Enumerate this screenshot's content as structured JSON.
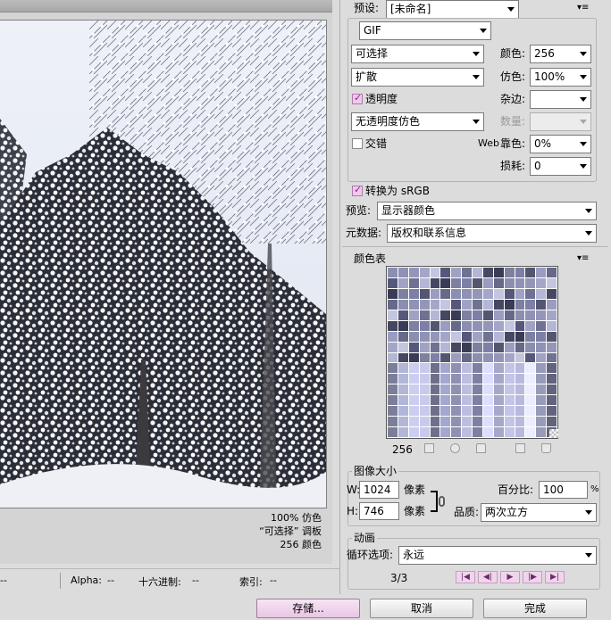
{
  "preview": {
    "dither_line": "100% 仿色",
    "palette_line": "“可选择” 调板",
    "colors_line": "256 颜色"
  },
  "status": {
    "left_value": "--",
    "alpha_label": "Alpha:",
    "alpha_value": "--",
    "hex_label": "十六进制:",
    "hex_value": "--",
    "index_label": "索引:",
    "index_value": "--"
  },
  "buttons": {
    "save": "存储...",
    "cancel": "取消",
    "done": "完成"
  },
  "settings": {
    "preset_label": "预设:",
    "preset_value": "[未命名]",
    "format": "GIF",
    "reduction": "可选择",
    "dither_algorithm": "扩散",
    "transparency_label": "透明度",
    "transparency_checked": true,
    "transparency_dither": "无透明度仿色",
    "interlaced_label": "交错",
    "interlaced_checked": false,
    "colors_label": "颜色:",
    "colors_value": "256",
    "dither_label": "仿色:",
    "dither_value": "100%",
    "matte_label": "杂边:",
    "matte_value": "",
    "amount_label": "数量:",
    "amount_value": "",
    "web_label": "Web",
    "web_snap_label": "靠色:",
    "web_snap_value": "0%",
    "lossy_label": "损耗:",
    "lossy_value": "0",
    "convert_srgb_label": "转换为 sRGB",
    "convert_srgb_checked": true,
    "preview_label": "预览:",
    "preview_value": "显示器颜色",
    "metadata_label": "元数据:",
    "metadata_value": "版权和联系信息"
  },
  "color_table": {
    "title": "颜色表",
    "count": "256",
    "palette": [
      "#8a8fb0",
      "#6f7290",
      "#9a9cc0",
      "#55587a",
      "#7c7fa6",
      "#a4a6c8",
      "#3a3c55",
      "#8f92b4",
      "#b4b6d6",
      "#666988",
      "#a0a2c4",
      "#545670",
      "#c4c6e0",
      "#7e80a0",
      "#9496b8",
      "#464862"
    ]
  },
  "image_size": {
    "title": "图像大小",
    "w_label": "W:",
    "w_value": "1024",
    "h_label": "H:",
    "h_value": "746",
    "unit": "像素",
    "percent_label": "百分比:",
    "percent_value": "100",
    "percent_unit": "%",
    "quality_label": "品质:",
    "quality_value": "两次立方"
  },
  "animation": {
    "title": "动画",
    "loop_label": "循环选项:",
    "loop_value": "永远",
    "frame_counter": "3/3"
  },
  "colors": {
    "accent": "#e8c6e4",
    "accent_border": "#9c7e98"
  }
}
